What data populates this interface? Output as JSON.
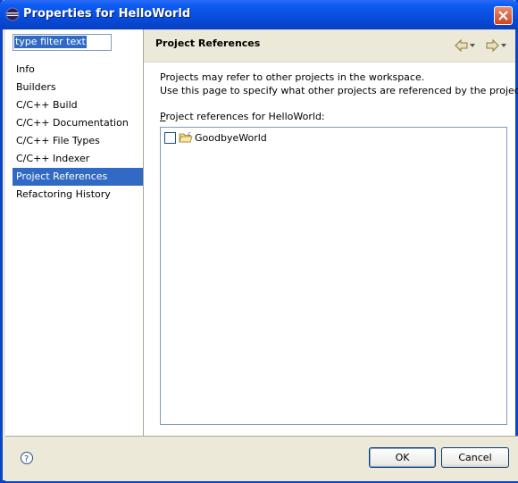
{
  "window": {
    "title": "Properties for HelloWorld"
  },
  "filter": {
    "value": "type filter text"
  },
  "nav": {
    "items": [
      {
        "label": "Info"
      },
      {
        "label": "Builders"
      },
      {
        "label": "C/C++ Build"
      },
      {
        "label": "C/C++ Documentation"
      },
      {
        "label": "C/C++ File Types"
      },
      {
        "label": "C/C++ Indexer"
      },
      {
        "label": "Project References",
        "selected": true
      },
      {
        "label": "Refactoring History"
      }
    ]
  },
  "page": {
    "title": "Project References",
    "description_line1": "Projects may refer to other projects in the workspace.",
    "description_line2": "Use this page to specify what other projects are referenced by the project.",
    "refs_label_mnemonic": "P",
    "refs_label_rest": "roject references for HelloWorld:",
    "projects": [
      {
        "name": "GoodbyeWorld",
        "checked": false
      }
    ]
  },
  "buttons": {
    "ok": "OK",
    "cancel": "Cancel"
  },
  "icons": {
    "title": "eclipse-icon",
    "close": "close-icon",
    "back": "back-arrow-icon",
    "forward": "forward-arrow-icon",
    "help": "help-icon",
    "folder": "project-folder-icon"
  },
  "colors": {
    "selection": "#316ac5",
    "titlebar": "#0b5af0"
  }
}
